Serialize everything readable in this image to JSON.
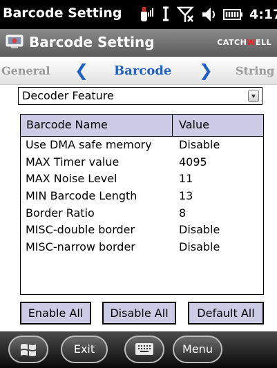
{
  "statusbar": {
    "title": "Barcode Setting",
    "time": "4:17",
    "icons": [
      "signal-icon",
      "antenna-icon",
      "no-data-connection-icon",
      "volume-icon",
      "battery-icon"
    ]
  },
  "appbar": {
    "title": "Barcode Setting",
    "brand_prefix": "CATCH",
    "brand_accent": "W",
    "brand_suffix": "ELL"
  },
  "tabs": {
    "left": "General",
    "current": "Barcode",
    "right": "String"
  },
  "dropdown": {
    "selected": "Decoder Feature"
  },
  "list": {
    "columns": [
      "Barcode Name",
      "Value"
    ],
    "rows": [
      {
        "name": "Use DMA safe memory",
        "value": "Disable"
      },
      {
        "name": "MAX Timer value",
        "value": "4095"
      },
      {
        "name": "MAX Noise Level",
        "value": "11"
      },
      {
        "name": "MIN Barcode Length",
        "value": "13"
      },
      {
        "name": "Border Ratio",
        "value": "8"
      },
      {
        "name": "MISC-double border",
        "value": "Disable"
      },
      {
        "name": "MISC-narrow border",
        "value": "Disable"
      }
    ]
  },
  "buttons": {
    "enable_all": "Enable All",
    "disable_all": "Disable All",
    "default_all": "Default All"
  },
  "softkeys": {
    "exit": "Exit",
    "menu": "Menu"
  },
  "colors": {
    "header_bg": "#cccce6",
    "tab_accent": "#2060c0",
    "brand_accent": "#e8232a"
  }
}
